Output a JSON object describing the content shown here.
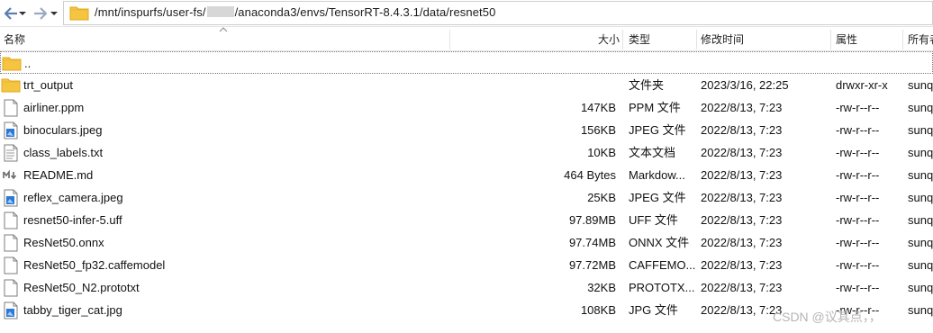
{
  "address": {
    "path_prefix": "/mnt/inspurfs/user-fs/",
    "path_suffix": "/anaconda3/envs/TensorRT-8.4.3.1/data/resnet50"
  },
  "nav": {
    "back_icon": "back-arrow-icon",
    "forward_icon": "forward-arrow-icon",
    "dropdown_icon": "chevron-down-icon",
    "folder_icon": "folder-icon"
  },
  "columns": {
    "name": "名称",
    "size": "大小",
    "type": "类型",
    "modified": "修改时间",
    "attributes": "属性",
    "owner": "所有者"
  },
  "files": [
    {
      "name": "..",
      "size": "",
      "type": "",
      "modified": "",
      "attributes": "",
      "owner": "",
      "icon": "folder",
      "parent": true
    },
    {
      "name": "trt_output",
      "size": "",
      "type": "文件夹",
      "modified": "2023/3/16, 22:25",
      "attributes": "drwxr-xr-x",
      "owner": "sunq",
      "icon": "folder"
    },
    {
      "name": "airliner.ppm",
      "size": "147KB",
      "type": "PPM 文件",
      "modified": "2022/8/13, 7:23",
      "attributes": "-rw-r--r--",
      "owner": "sunq",
      "icon": "blank"
    },
    {
      "name": "binoculars.jpeg",
      "size": "156KB",
      "type": "JPEG 文件",
      "modified": "2022/8/13, 7:23",
      "attributes": "-rw-r--r--",
      "owner": "sunq",
      "icon": "image"
    },
    {
      "name": "class_labels.txt",
      "size": "10KB",
      "type": "文本文档",
      "modified": "2022/8/13, 7:23",
      "attributes": "-rw-r--r--",
      "owner": "sunq",
      "icon": "text"
    },
    {
      "name": "README.md",
      "size": "464 Bytes",
      "type": "Markdow...",
      "modified": "2022/8/13, 7:23",
      "attributes": "-rw-r--r--",
      "owner": "sunq",
      "icon": "markdown"
    },
    {
      "name": "reflex_camera.jpeg",
      "size": "25KB",
      "type": "JPEG 文件",
      "modified": "2022/8/13, 7:23",
      "attributes": "-rw-r--r--",
      "owner": "sunq",
      "icon": "image"
    },
    {
      "name": "resnet50-infer-5.uff",
      "size": "97.89MB",
      "type": "UFF 文件",
      "modified": "2022/8/13, 7:23",
      "attributes": "-rw-r--r--",
      "owner": "sunq",
      "icon": "blank"
    },
    {
      "name": "ResNet50.onnx",
      "size": "97.74MB",
      "type": "ONNX 文件",
      "modified": "2022/8/13, 7:23",
      "attributes": "-rw-r--r--",
      "owner": "sunq",
      "icon": "blank"
    },
    {
      "name": "ResNet50_fp32.caffemodel",
      "size": "97.72MB",
      "type": "CAFFEMO...",
      "modified": "2022/8/13, 7:23",
      "attributes": "-rw-r--r--",
      "owner": "sunq",
      "icon": "blank"
    },
    {
      "name": "ResNet50_N2.prototxt",
      "size": "32KB",
      "type": "PROTOTX...",
      "modified": "2022/8/13, 7:23",
      "attributes": "-rw-r--r--",
      "owner": "sunq",
      "icon": "blank"
    },
    {
      "name": "tabby_tiger_cat.jpg",
      "size": "108KB",
      "type": "JPG 文件",
      "modified": "2022/8/13, 7:23",
      "attributes": "-rw-r--r--",
      "owner": "sunq",
      "icon": "image"
    }
  ],
  "watermark": "CSDN @议其点，，",
  "colors": {
    "folder": "#f5c542",
    "folder_dark": "#e0a91c",
    "image_blue": "#2b78d6",
    "nav_arrow": "#5b7fb0"
  }
}
